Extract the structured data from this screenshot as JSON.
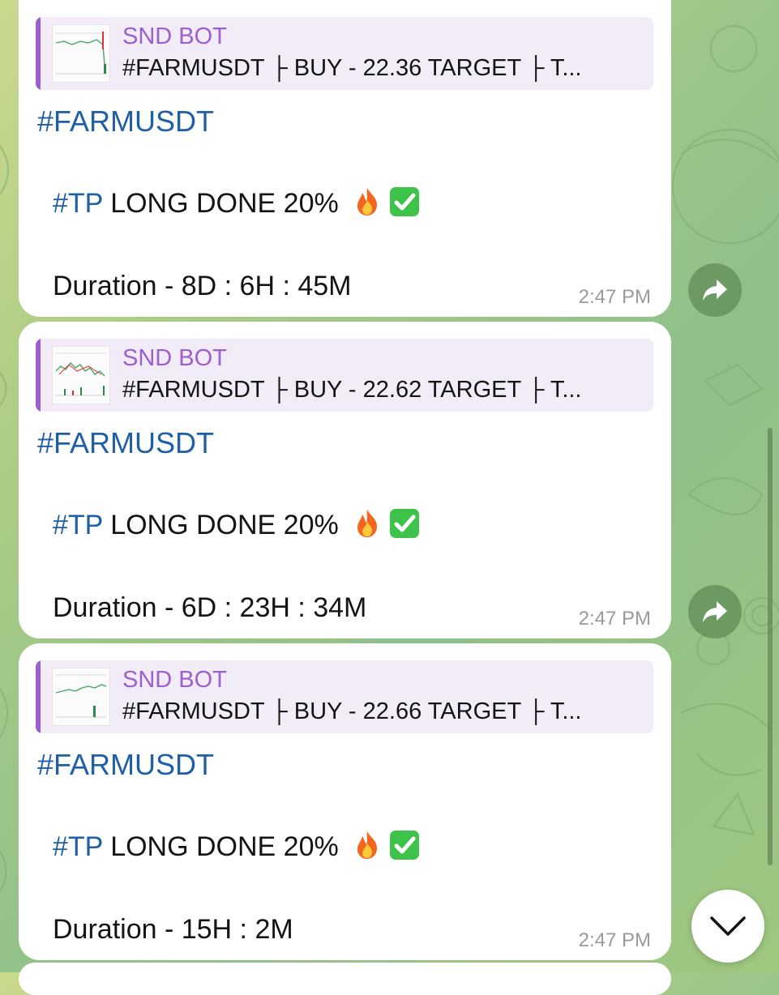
{
  "messages": [
    {
      "reply": {
        "sender": "SND BOT",
        "text": "#FARMUSDT  ├ BUY - 22.36 TARGET  ├ T..."
      },
      "hashtag": "#FARMUSDT",
      "tp_tag": "#TP",
      "tp_text": " LONG DONE 20%",
      "duration": "Duration - 8D : 6H : 45M",
      "time": "2:47 PM"
    },
    {
      "reply": {
        "sender": "SND BOT",
        "text": "#FARMUSDT  ├ BUY - 22.62 TARGET  ├ T..."
      },
      "hashtag": "#FARMUSDT",
      "tp_tag": "#TP",
      "tp_text": " LONG DONE 20%",
      "duration": "Duration - 6D : 23H : 34M",
      "time": "2:47 PM"
    },
    {
      "reply": {
        "sender": "SND BOT",
        "text": "#FARMUSDT  ├ BUY - 22.66 TARGET  ├ T..."
      },
      "hashtag": "#FARMUSDT",
      "tp_tag": "#TP",
      "tp_text": " LONG DONE 20%",
      "duration": "Duration - 15H : 2M",
      "time": "2:47 PM"
    }
  ],
  "colors": {
    "sender": "#9d5fd0",
    "hashtag": "#1f5fa8",
    "reply_bg": "#f1ecf8",
    "forward_button": "#608c56"
  },
  "icons": {
    "emoji_1": "fire-icon",
    "emoji_2": "check-mark-button-icon",
    "forward": "share-arrow-icon",
    "scroll": "chevron-down-icon"
  }
}
